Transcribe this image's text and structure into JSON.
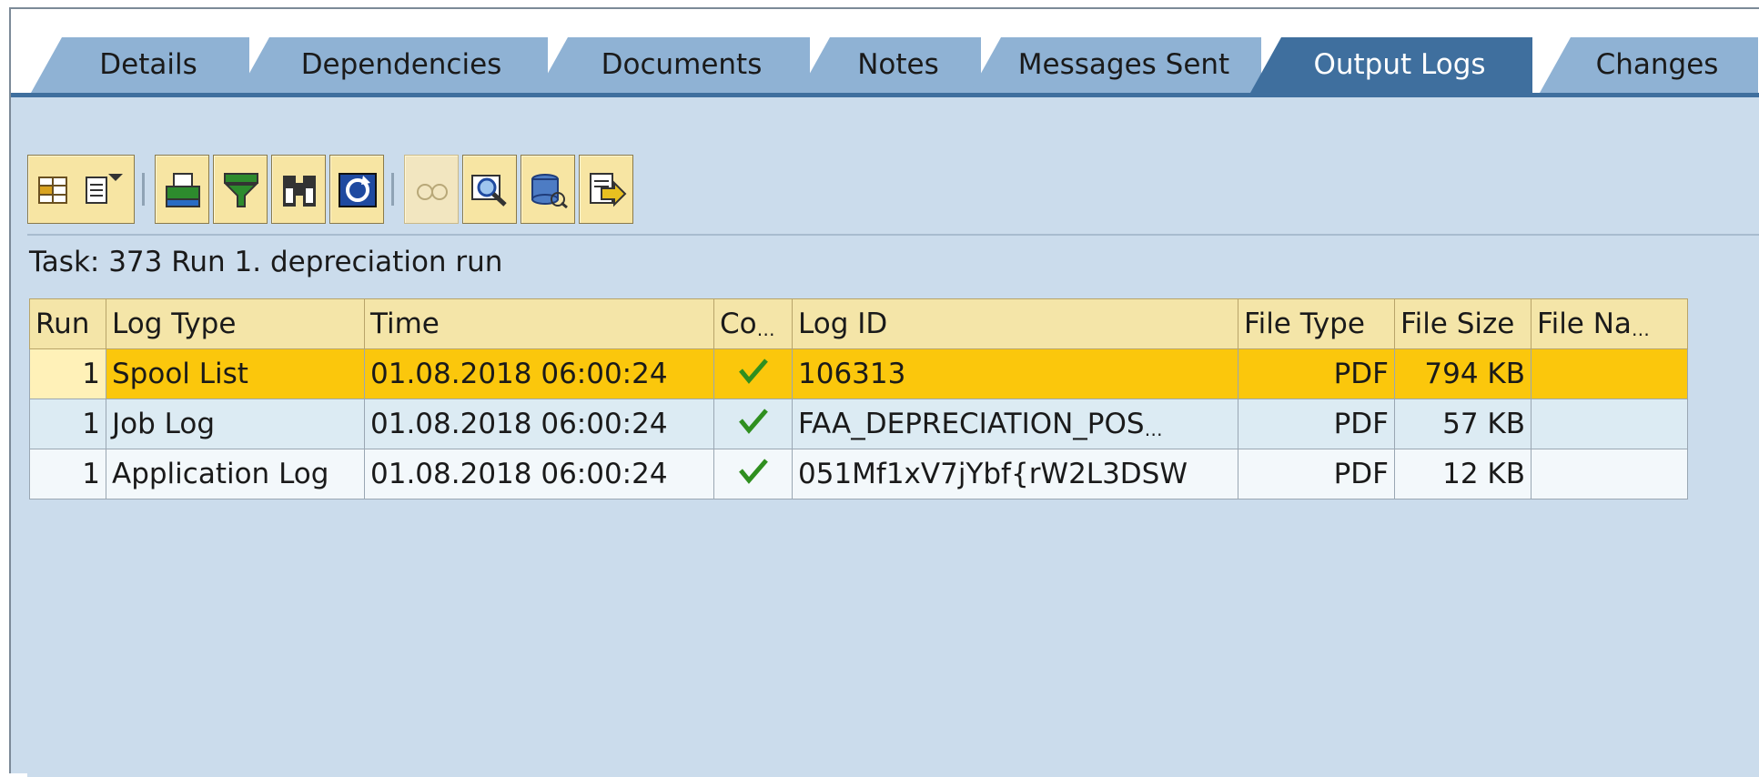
{
  "tabs": [
    {
      "label": "Details",
      "active": false
    },
    {
      "label": "Dependencies",
      "active": false
    },
    {
      "label": "Documents",
      "active": false
    },
    {
      "label": "Notes",
      "active": false
    },
    {
      "label": "Messages Sent",
      "active": false
    },
    {
      "label": "Output Logs",
      "active": true
    },
    {
      "label": "Changes",
      "active": false
    }
  ],
  "toolbar": {
    "icons": [
      "layout-menu-icon",
      "print-icon",
      "filter-icon",
      "find-icon",
      "refresh-icon",
      "display-disabled-icon",
      "zoom-detail-icon",
      "database-display-icon",
      "export-icon"
    ]
  },
  "task_title": "Task: 373 Run 1. depreciation run",
  "table": {
    "headers": {
      "run": "Run",
      "log_type": "Log Type",
      "time": "Time",
      "co": "Co",
      "log_id": "Log ID",
      "file_type": "File Type",
      "file_size": "File Size",
      "file_name": "File Na"
    },
    "rows": [
      {
        "run": "1",
        "log_type": "Spool List",
        "time": "01.08.2018 06:00:24",
        "status_icon": "green-check-icon",
        "log_id": "106313",
        "file_type": "PDF",
        "file_size": "794 KB",
        "file_name": "",
        "selected": true
      },
      {
        "run": "1",
        "log_type": "Job Log",
        "time": "01.08.2018 06:00:24",
        "status_icon": "green-check-icon",
        "log_id": "FAA_DEPRECIATION_POS",
        "file_type": "PDF",
        "file_size": "57 KB",
        "file_name": ""
      },
      {
        "run": "1",
        "log_type": "Application Log",
        "time": "01.08.2018 06:00:24",
        "status_icon": "green-check-icon",
        "log_id": "051Mf1xV7jYbf{rW2L3DSW",
        "file_type": "PDF",
        "file_size": "12 KB",
        "file_name": ""
      }
    ]
  },
  "colors": {
    "background": "#cbdcec",
    "active_tab": "#3f6f9e",
    "inactive_tab": "#8fb2d4",
    "selected_row": "#fbc70c",
    "header_bg": "#f4e5a8"
  }
}
